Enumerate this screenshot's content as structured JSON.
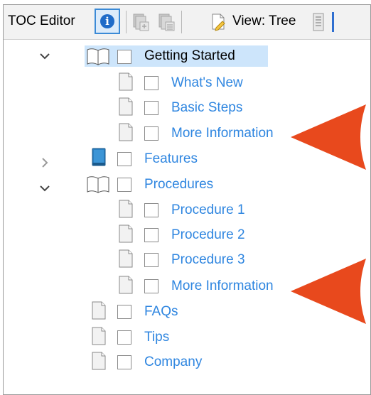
{
  "toolbar": {
    "title": "TOC Editor",
    "view_label": "View: Tree",
    "icons": [
      "info-icon",
      "book-add-icon",
      "book-properties-icon",
      "topic-edit-icon",
      "view-tree-icon",
      "toc-list-icon"
    ]
  },
  "tree": {
    "items": [
      {
        "label": "Getting Started",
        "type": "book-open",
        "expanded": true,
        "selected": true
      },
      {
        "label": "What's New",
        "type": "topic"
      },
      {
        "label": "Basic Steps",
        "type": "topic"
      },
      {
        "label": "More Information",
        "type": "topic"
      },
      {
        "label": "Features",
        "type": "book-closed",
        "expanded": false
      },
      {
        "label": "Procedures",
        "type": "book-open",
        "expanded": true
      },
      {
        "label": "Procedure 1",
        "type": "topic"
      },
      {
        "label": "Procedure 2",
        "type": "topic"
      },
      {
        "label": "Procedure 3",
        "type": "topic"
      },
      {
        "label": "More Information",
        "type": "topic"
      },
      {
        "label": "FAQs",
        "type": "topic"
      },
      {
        "label": "Tips",
        "type": "topic"
      },
      {
        "label": "Company",
        "type": "topic"
      }
    ]
  },
  "colors": {
    "link_blue": "#2f86e0",
    "selection": "#cde5fb",
    "callout_arrow": "#e8491d",
    "book_blue": "#2a7fc1"
  }
}
